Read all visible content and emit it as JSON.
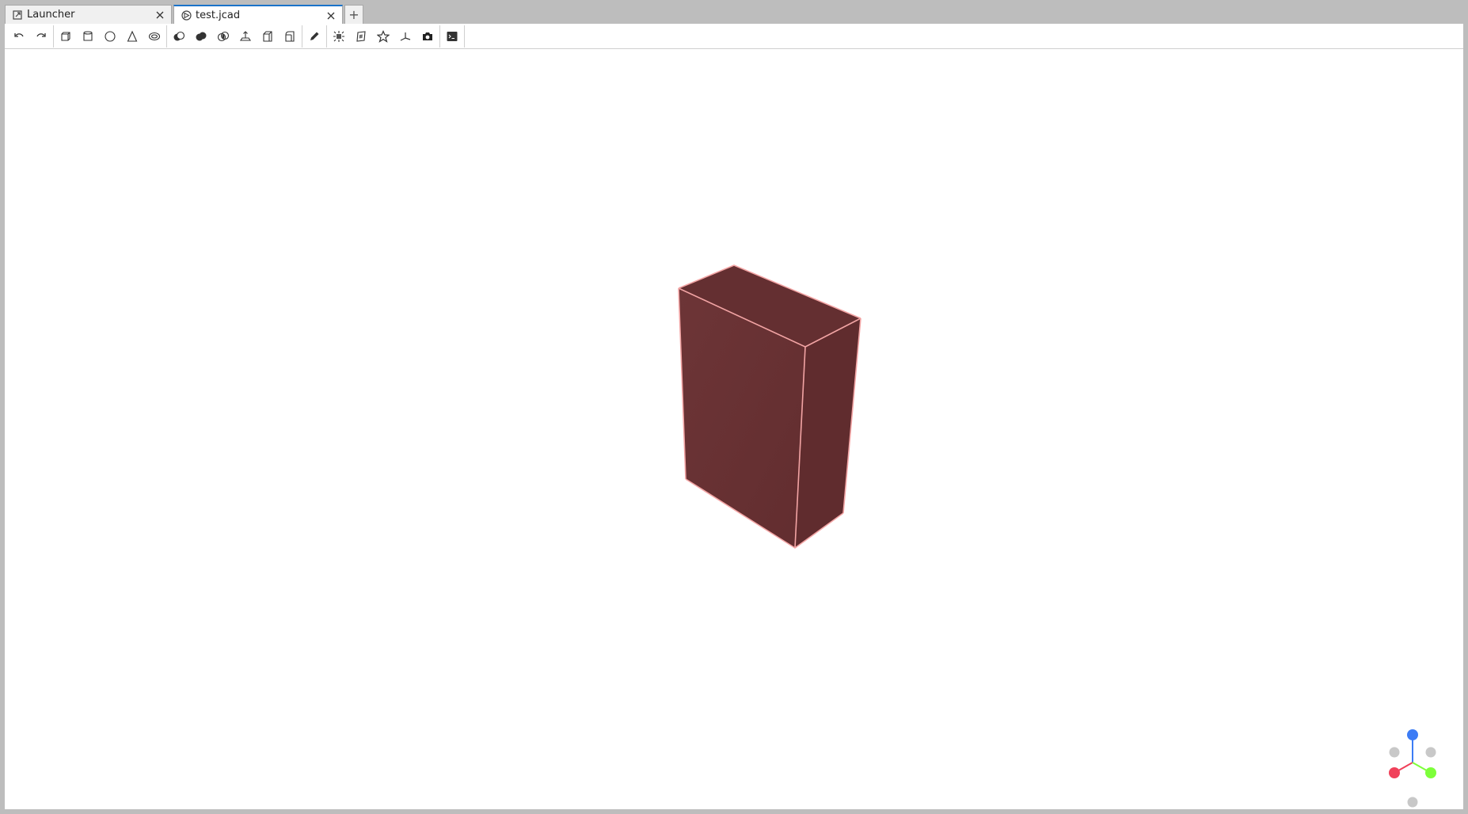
{
  "tabs": [
    {
      "label": "Launcher",
      "icon": "launcher-icon"
    },
    {
      "label": "test.jcad",
      "icon": "jcad-file-icon"
    }
  ],
  "new_tab_label": "+",
  "toolbar": {
    "groups": [
      [
        "undo-icon",
        "redo-icon"
      ],
      [
        "box-icon",
        "cylinder-icon",
        "sphere-icon",
        "cone-icon",
        "torus-icon"
      ],
      [
        "cut-icon",
        "fuse-icon",
        "intersection-icon",
        "extrusion-icon",
        "chamfer-icon",
        "fillet-icon"
      ],
      [
        "sketch-pencil-icon"
      ],
      [
        "explode-icon",
        "clip-plane-icon",
        "wireframe-icon",
        "axes-icon",
        "screenshot-icon"
      ],
      [
        "terminal-icon"
      ]
    ]
  },
  "scene": {
    "solid_color": "#6b3335",
    "edge_color": "#f2a4a4"
  },
  "axes_colors": {
    "x": "#f0415a",
    "y": "#7dff3a",
    "z": "#3c7cf5",
    "neutral": "#c8c8c8"
  }
}
